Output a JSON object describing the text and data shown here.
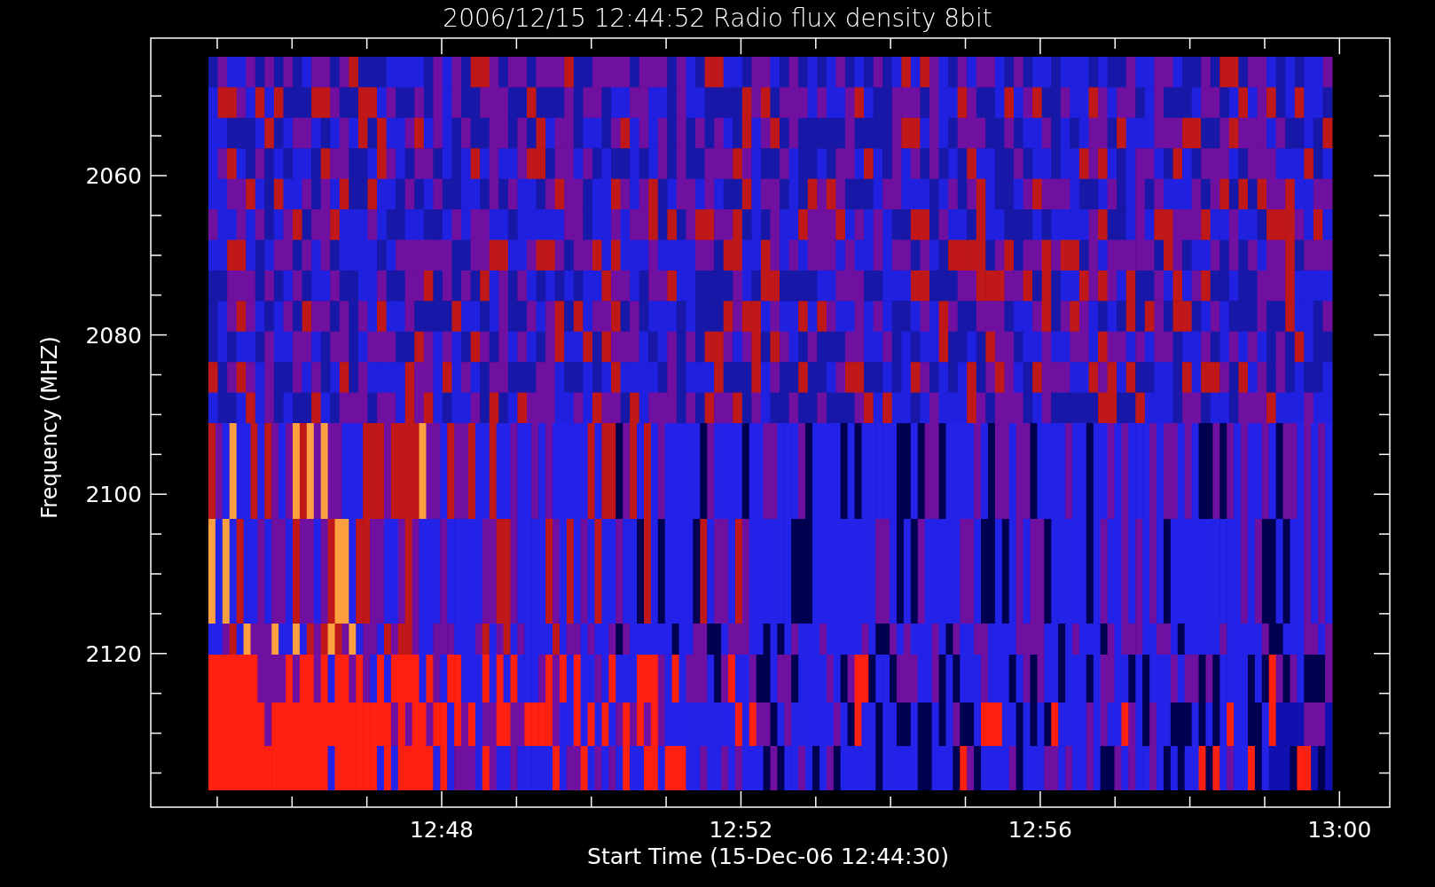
{
  "title": "2006/12/15 12:44:52 Radio flux density 8bit",
  "y_axis": {
    "label": "Frequency (MHZ)",
    "ticks": [
      "2060",
      "2080",
      "2100",
      "2120"
    ]
  },
  "x_axis": {
    "label": "Start Time (15-Dec-06 12:44:30)",
    "ticks": [
      "12:48",
      "12:52",
      "12:56",
      "13:00"
    ]
  }
}
